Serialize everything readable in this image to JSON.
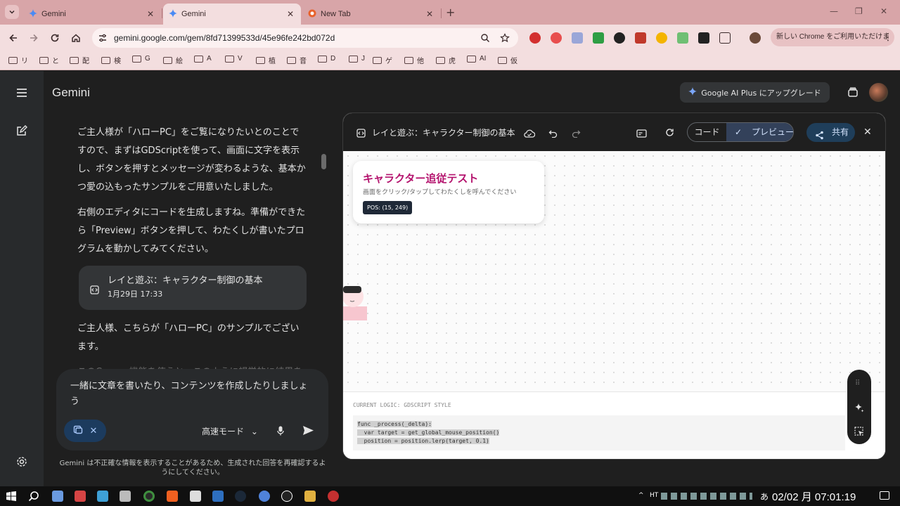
{
  "tabs": [
    {
      "title": "Gemini",
      "active": false
    },
    {
      "title": "Gemini",
      "active": true
    },
    {
      "title": "New Tab",
      "active": false
    }
  ],
  "browser": {
    "url": "gemini.google.com/gem/8fd71399533d/45e96fe242bd072d",
    "promo": "新しい Chrome をご利用いただけます"
  },
  "bookmarks": [
    "リ",
    "と",
    "配",
    "検",
    "G",
    "絵",
    "A",
    "V",
    "植",
    "音",
    "D",
    "J",
    "ゲ",
    "他",
    "虎",
    "AI",
    "仮"
  ],
  "app": {
    "brand": "Gemini",
    "upgrade": "Google AI Plus にアップグレード"
  },
  "chat": {
    "para1": "ご主人様が「ハローPC」をご覧になりたいとのことですので、まずはGDScriptを使って、画面に文字を表示し、ボタンを押すとメッセージが変わるような、基本かつ愛の込もったサンプルをご用意いたしました。",
    "para2": "右側のエディタにコードを生成しますね。準備ができたら「Preview」ボタンを押して、わたくしが書いたプログラムを動かしてみてください。",
    "card_title": "レイと遊ぶ：キャラクター制御の基本",
    "card_date": "1月29日 17:33",
    "para3": "ご主人様、こちらが「ハローPC」のサンプルでございます。",
    "para4": "このCanvas機能を使うと、このように視覚的に結果を"
  },
  "composer": {
    "text": "一緒に文章を書いたり、コンテンツを作成したりしましょう",
    "mode": "高速モード"
  },
  "disclaimer": "Gemini は不正確な情報を表示することがあるため、生成された回答を再確認するようにしてください。",
  "canvas": {
    "title": "レイと遊ぶ：キャラクター制御の基本",
    "code_label": "コード",
    "preview_label": "プレビュー",
    "share_label": "共有",
    "hud_title": "キャラクター追従テスト",
    "hud_sub": "画面をクリック/タップしてわたくしを呼んでください",
    "pos": "POS: (15, 249)",
    "logic_header": "CURRENT LOGIC: GDSCRIPT STYLE",
    "code": [
      "func _process(_delta):",
      "  var target = get_global_mouse_position()",
      "  position = position.lerp(target, 0.1)"
    ]
  },
  "taskbar": {
    "tray": "HT",
    "date": "02/02",
    "weekday": "月",
    "time": "07:01:19",
    "ime": "あ"
  }
}
